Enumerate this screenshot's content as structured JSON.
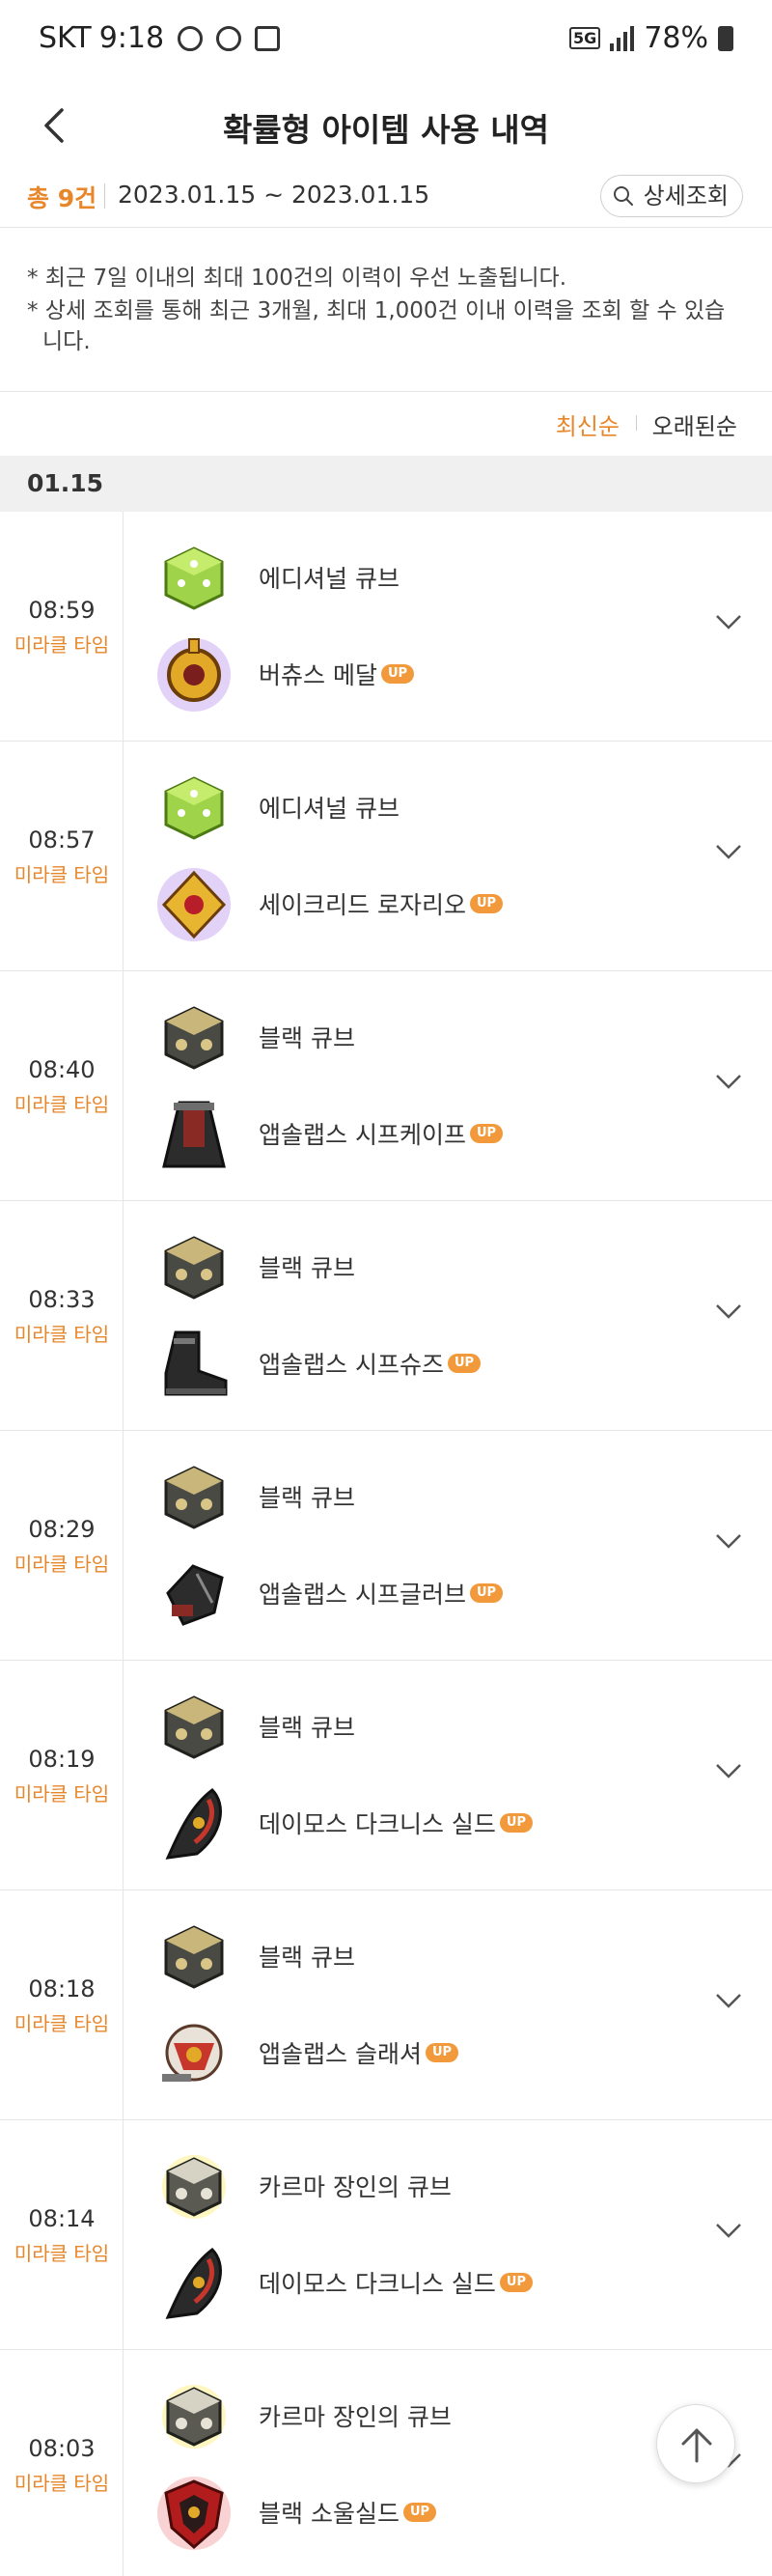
{
  "status_bar": {
    "carrier": "SKT",
    "time": "9:18",
    "network": "5G",
    "battery": "78%"
  },
  "header": {
    "title": "확률형 아이템 사용 내역"
  },
  "summary": {
    "total": "총 9건",
    "date_range": "2023.01.15 ~ 2023.01.15",
    "detail_button": "상세조회"
  },
  "notices": [
    "* 최근 7일 이내의 최대 100건의 이력이 우선 노출됩니다.",
    "* 상세 조회를 통해 최근 3개월, 최대 1,000건 이내 이력을 조회 할 수 있습니다."
  ],
  "sort": {
    "latest": "최신순",
    "oldest": "오래된순"
  },
  "date_group": "01.15",
  "up_label": "UP",
  "entries": [
    {
      "time": "08:59",
      "type": "미라클 타임",
      "cube": "에디셔널 큐브",
      "item": "버츄스 메달"
    },
    {
      "time": "08:57",
      "type": "미라클 타임",
      "cube": "에디셔널 큐브",
      "item": "세이크리드 로자리오"
    },
    {
      "time": "08:40",
      "type": "미라클 타임",
      "cube": "블랙 큐브",
      "item": "앱솔랩스 시프케이프"
    },
    {
      "time": "08:33",
      "type": "미라클 타임",
      "cube": "블랙 큐브",
      "item": "앱솔랩스 시프슈즈"
    },
    {
      "time": "08:29",
      "type": "미라클 타임",
      "cube": "블랙 큐브",
      "item": "앱솔랩스 시프글러브"
    },
    {
      "time": "08:19",
      "type": "미라클 타임",
      "cube": "블랙 큐브",
      "item": "데이모스 다크니스 실드"
    },
    {
      "time": "08:18",
      "type": "미라클 타임",
      "cube": "블랙 큐브",
      "item": "앱솔랩스 슬래셔"
    },
    {
      "time": "08:14",
      "type": "미라클 타임",
      "cube": "카르마 장인의 큐브",
      "item": "데이모스 다크니스 실드"
    },
    {
      "time": "08:03",
      "type": "미라클 타임",
      "cube": "카르마 장인의 큐브",
      "item": "블랙 소울실드"
    }
  ]
}
